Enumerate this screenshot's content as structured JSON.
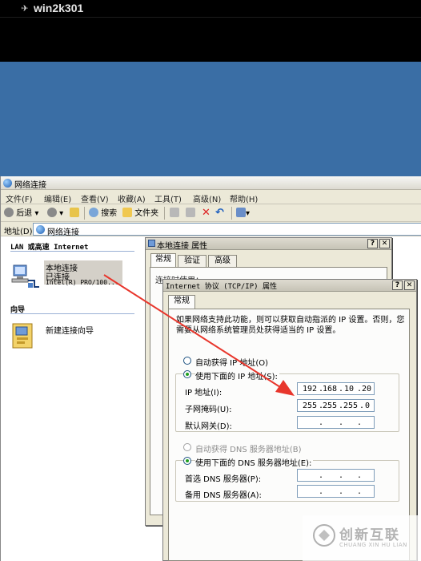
{
  "session": {
    "title": "win2k301"
  },
  "explorer": {
    "title": "网络连接",
    "menu": [
      "文件(F)",
      "编辑(E)",
      "查看(V)",
      "收藏(A)",
      "工具(T)",
      "高级(N)",
      "帮助(H)"
    ],
    "toolbar": {
      "back": "后退",
      "search": "搜索",
      "folders": "文件夹"
    },
    "address": {
      "label": "地址(D)",
      "value": "网络连接"
    },
    "groups": {
      "lan": "LAN 或高速 Internet",
      "wizard": "向导"
    },
    "lan_item": {
      "name": "本地连接",
      "status": "已连接",
      "device": "Intel(R) PRO/100..."
    },
    "wizard_item": {
      "name": "新建连接向导"
    }
  },
  "props_dialog": {
    "title": "本地连接 属性",
    "tabs": [
      "常规",
      "验证",
      "高级"
    ],
    "obscured_text": "连接时使用："
  },
  "tcpip_dialog": {
    "title": "Internet 协议 (TCP/IP) 属性",
    "tab": "常规",
    "info": "如果网络支持此功能，则可以获取自动指派的 IP 设置。否则，您需要从网络系统管理员处获得适当的 IP 设置。",
    "auto_ip": "自动获得 IP 地址(O)",
    "manual_ip": "使用下面的 IP 地址(S):",
    "ip_label": "IP 地址(I):",
    "ip_value": [
      "192",
      "168",
      "10",
      "20"
    ],
    "mask_label": "子网掩码(U):",
    "mask_value": [
      "255",
      "255",
      "255",
      "0"
    ],
    "gateway_label": "默认网关(D):",
    "auto_dns": "自动获得 DNS 服务器地址(B)",
    "manual_dns": "使用下面的 DNS 服务器地址(E):",
    "pref_dns_label": "首选 DNS 服务器(P):",
    "alt_dns_label": "备用 DNS 服务器(A):"
  },
  "watermark": {
    "cn": "创新互联",
    "en": "CHUANG XIN HU LIAN"
  },
  "colors": {
    "desktop": "#3a6ea5",
    "window": "#ece9d8",
    "arrow": "#e8362c",
    "selected_radio": "#21a121"
  }
}
